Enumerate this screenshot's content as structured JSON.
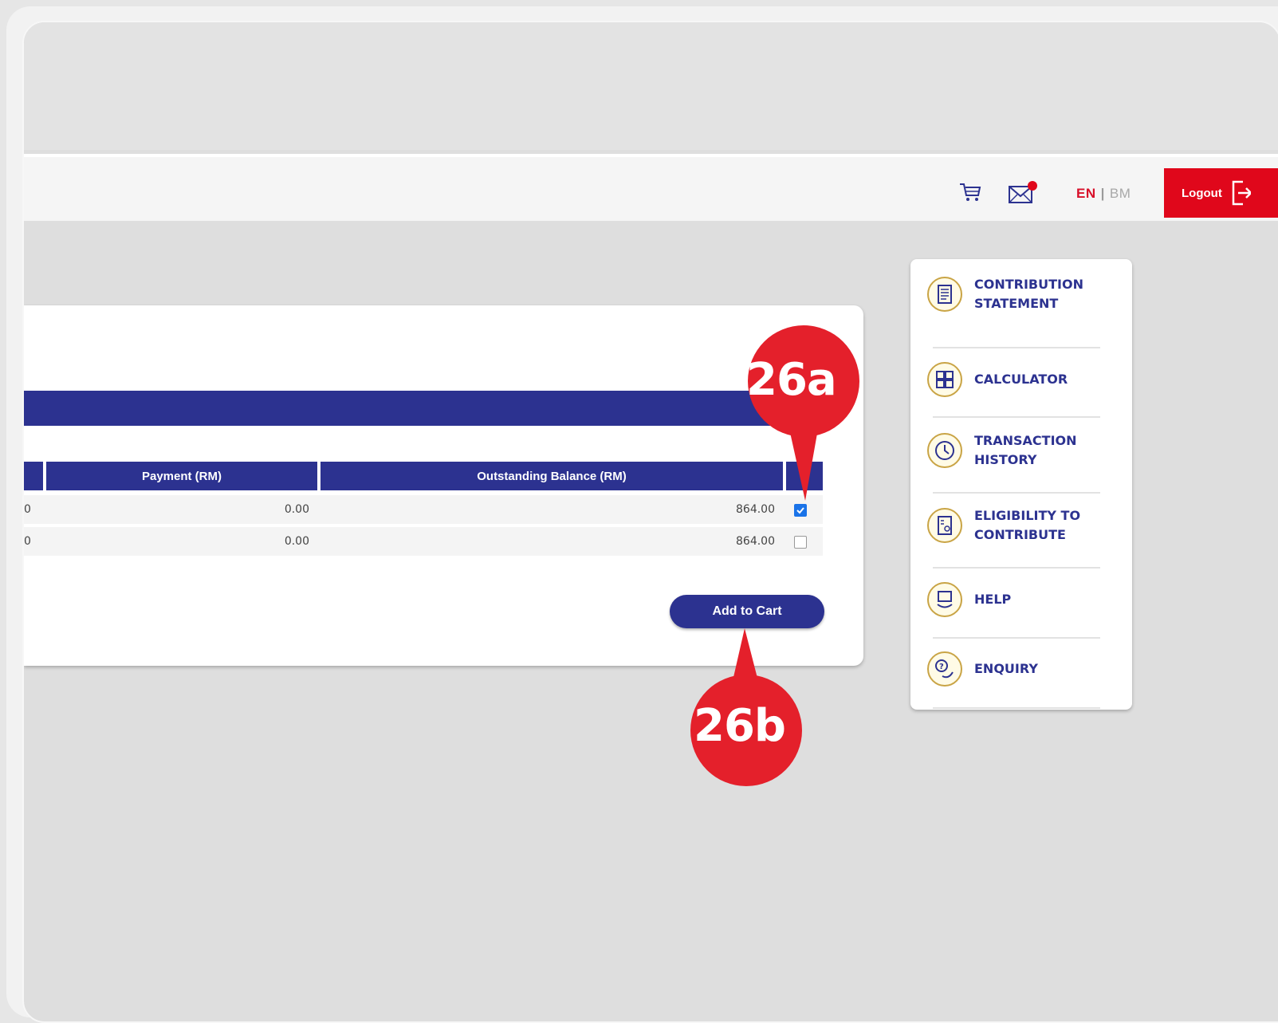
{
  "header": {
    "lang_en": "EN",
    "lang_separator": "|",
    "lang_bm": "BM",
    "logout_label": "Logout",
    "notification_dot_color": "#e0071b"
  },
  "table": {
    "columns": [
      "Payment (RM)",
      "Outstanding Balance (RM)"
    ],
    "rows": [
      {
        "partial_prev": "0",
        "payment": "0.00",
        "outstanding": "864.00",
        "checked": true
      },
      {
        "partial_prev": "0",
        "payment": "0.00",
        "outstanding": "864.00",
        "checked": false
      }
    ],
    "add_to_cart_label": "Add to Cart"
  },
  "sidebar": {
    "items": [
      {
        "label_line1": "CONTRIBUTION",
        "label_line2": "STATEMENT",
        "icon": "document-icon"
      },
      {
        "label_line1": "CALCULATOR",
        "label_line2": "",
        "icon": "calculator-icon"
      },
      {
        "label_line1": "TRANSACTION",
        "label_line2": "HISTORY",
        "icon": "clock-icon"
      },
      {
        "label_line1": "ELIGIBILITY TO",
        "label_line2": "CONTRIBUTE",
        "icon": "eligibility-icon"
      },
      {
        "label_line1": "HELP",
        "label_line2": "",
        "icon": "help-icon"
      },
      {
        "label_line1": "ENQUIRY",
        "label_line2": "",
        "icon": "enquiry-icon"
      }
    ]
  },
  "annotations": {
    "marker_a": "26a",
    "marker_b": "26b",
    "color": "#e4202b"
  }
}
